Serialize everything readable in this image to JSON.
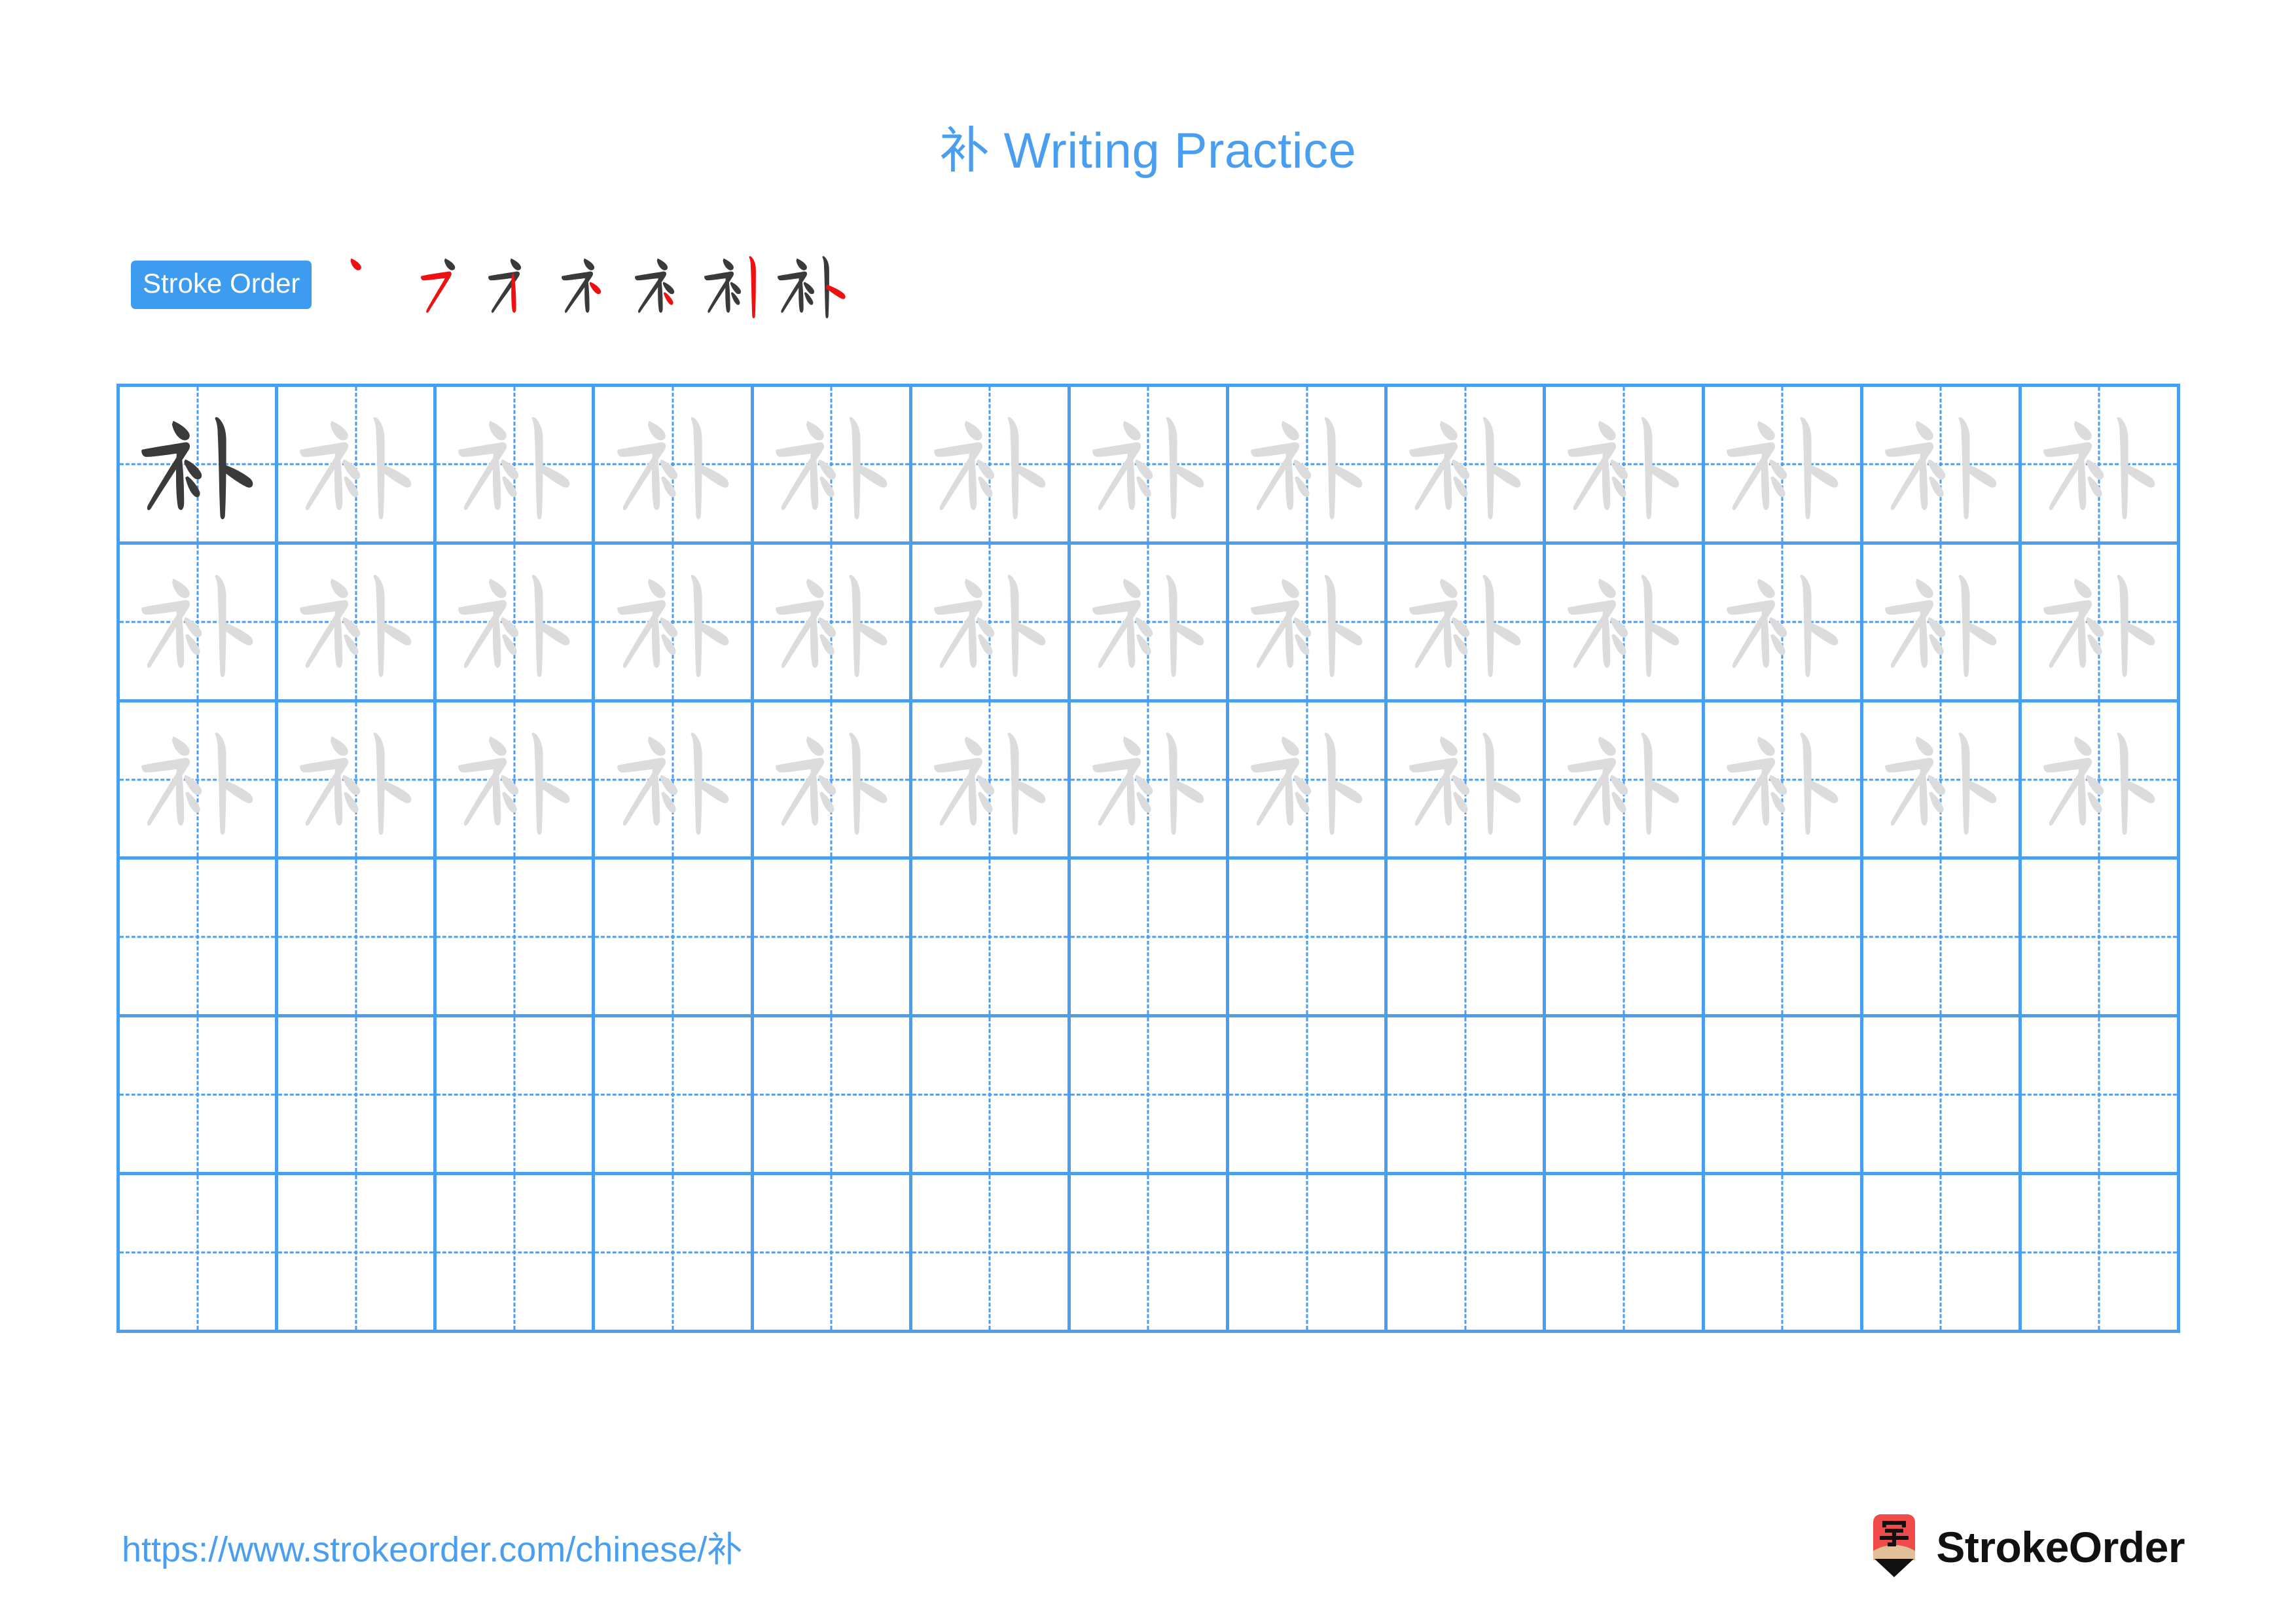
{
  "page": {
    "title": "补 Writing Practice",
    "character": "补",
    "title_color": "#4a9ef0",
    "grid_line_color": "#4a9ef0",
    "trace_glyph_color": "#dcdcdc",
    "model_glyph_color": "#3a3a3a",
    "new_stroke_color": "#ee1111"
  },
  "stroke_order": {
    "badge_label": "Stroke Order",
    "badge_bg": "#3d9bf0",
    "badge_text_color": "#ffffff",
    "step_count": 7,
    "steps": [
      {
        "index": 1,
        "strokes_shown": 1,
        "new_stroke": 1,
        "glyph": "丶"
      },
      {
        "index": 2,
        "strokes_shown": 2,
        "new_stroke": 2,
        "glyph": "冫"
      },
      {
        "index": 3,
        "strokes_shown": 3,
        "new_stroke": 3,
        "glyph": "礻"
      },
      {
        "index": 4,
        "strokes_shown": 4,
        "new_stroke": 4,
        "glyph": "礻"
      },
      {
        "index": 5,
        "strokes_shown": 5,
        "new_stroke": 5,
        "glyph": "衤"
      },
      {
        "index": 6,
        "strokes_shown": 6,
        "new_stroke": 6,
        "glyph": "补"
      },
      {
        "index": 7,
        "strokes_shown": 7,
        "new_stroke": 7,
        "glyph": "补"
      }
    ]
  },
  "practice_grid": {
    "columns": 13,
    "rows": 6,
    "model_cell": {
      "row": 1,
      "column": 1
    },
    "filled_rows": 3,
    "empty_rows": 3,
    "cell_character": "补"
  },
  "footer": {
    "url": "https://www.strokeorder.com/chinese/补",
    "url_color": "#4a9ef0",
    "brand_name": "StrokeOrder",
    "brand_mark_character": "字",
    "brand_mark_body_color": "#f04a4a",
    "brand_mark_tip_color": "#e0bf9a"
  }
}
